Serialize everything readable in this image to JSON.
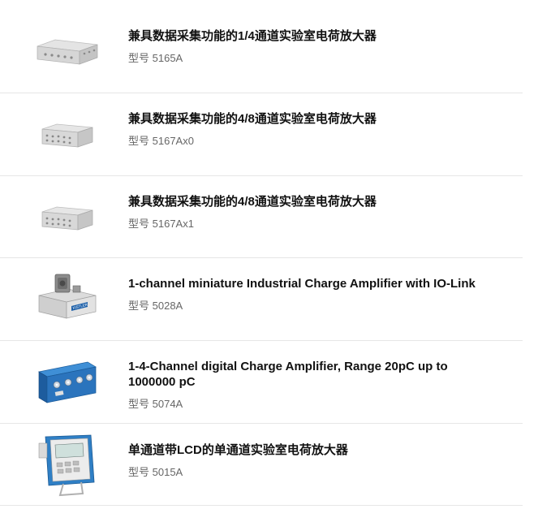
{
  "products": [
    {
      "title": "兼具数据采集功能的1/4通道实验室电荷放大器",
      "model_prefix": "型号",
      "model_number": "5165A",
      "image": "grey-box-amplifier-4ch-image"
    },
    {
      "title": "兼具数据采集功能的4/8通道实验室电荷放大器",
      "model_prefix": "型号",
      "model_number": "5167Ax0",
      "image": "grey-box-amplifier-8ch-image"
    },
    {
      "title": "兼具数据采集功能的4/8通道实验室电荷放大器",
      "model_prefix": "型号",
      "model_number": "5167Ax1",
      "image": "grey-box-amplifier-8ch-image"
    },
    {
      "title": "1-channel miniature Industrial Charge Amplifier with IO-Link",
      "model_prefix": "型号",
      "model_number": "5028A",
      "image": "miniature-amplifier-kistler-image",
      "logo_text": "KISTLER"
    },
    {
      "title": "1-4-Channel digital Charge Amplifier, Range 20pC up to 1000000 pC",
      "model_prefix": "型号",
      "model_number": "5074A",
      "image": "blue-multichannel-amplifier-image"
    },
    {
      "title": "单通道带LCD的单通道实验室电荷放大器",
      "model_prefix": "型号",
      "model_number": "5015A",
      "image": "handheld-lcd-amplifier-image"
    }
  ],
  "colors": {
    "title": "#111111",
    "model": "#666666",
    "divider": "#e6e6e6",
    "kistler_blue": "#1c5fa8"
  }
}
